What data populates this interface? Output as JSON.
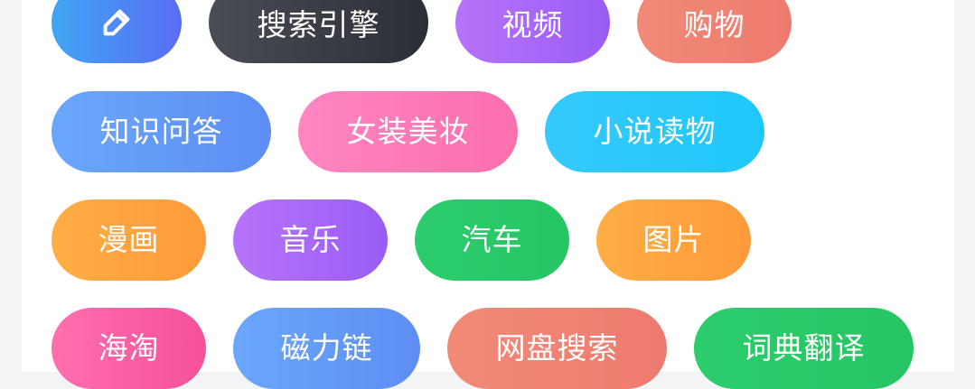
{
  "tags": {
    "row1": [
      "搜索引擎",
      "视频",
      "购物"
    ],
    "row2": [
      "知识问答",
      "女装美妆",
      "小说读物"
    ],
    "row3": [
      "漫画",
      "音乐",
      "汽车",
      "图片"
    ],
    "row4": [
      "海淘",
      "磁力链",
      "网盘搜索",
      "词典翻译"
    ]
  },
  "icons": {
    "edit": "pencil-icon"
  },
  "colors": {
    "edit": "#5b6cf5",
    "search_engine": "#2b2e35",
    "video": "#9a5cf5",
    "shopping": "#ee7a6f",
    "qa": "#5e8df4",
    "beauty": "#fb6fae",
    "novels": "#1ec7fa",
    "comics": "#ff9a3a",
    "music": "#9a5cf5",
    "cars": "#26c563",
    "images": "#ff9a3a",
    "overseas": "#f6509a",
    "magnet": "#5e8df4",
    "netdisk": "#ee7a6f",
    "dictionary": "#26c563"
  }
}
